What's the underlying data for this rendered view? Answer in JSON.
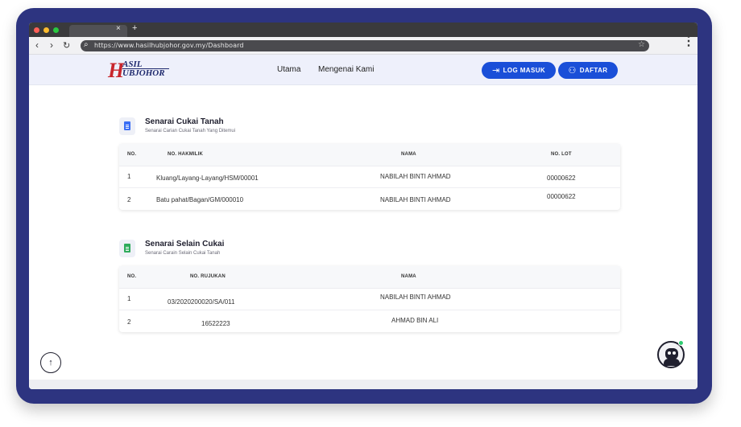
{
  "browser": {
    "tab_close": "×",
    "tab_new": "+",
    "url": "https://www.hasilhubjohor.gov.my/Dashboard"
  },
  "header": {
    "logo": {
      "big_letter": "H",
      "top_text": "ASIL",
      "bottom_text": "UBJOHOR"
    },
    "nav": [
      {
        "label": "Utama"
      },
      {
        "label": "Mengenai Kami"
      }
    ],
    "login_label": "LOG MASUK",
    "register_label": "DAFTAR"
  },
  "tax_section": {
    "title": "Senarai Cukai Tanah",
    "subtitle": "Senarai Carian Cukai Tanah Yang Ditemui",
    "icon_color": "#3b6ff5",
    "columns": [
      "NO.",
      "NO. HAKMILIK",
      "NAMA",
      "NO. LOT"
    ],
    "rows": [
      {
        "no": "1",
        "hakmilik": "Kluang/Layang-Layang/HSM/00001",
        "nama": "NABILAH BINTI AHMAD",
        "lot": "00000622"
      },
      {
        "no": "2",
        "hakmilik": "Batu pahat/Bagan/GM/000010",
        "nama": "NABILAH BINTI AHMAD",
        "lot": "00000622"
      }
    ]
  },
  "nontax_section": {
    "title": "Senarai Selain Cukai",
    "subtitle": "Senarai Carain Selain Cukai Tanah",
    "icon_color": "#2eab5b",
    "columns": [
      "NO.",
      "NO. RUJUKAN",
      "NAMA"
    ],
    "rows": [
      {
        "no": "1",
        "rujukan": "03/2020200020/SA/011",
        "nama": "NABILAH BINTI AHMAD"
      },
      {
        "no": "2",
        "rujukan": "16522223",
        "nama": "AHMAD BIN ALI"
      }
    ]
  },
  "colors": {
    "frame": "#2d3480",
    "primary": "#1a4fd8",
    "header_bg": "#eef0fb"
  }
}
